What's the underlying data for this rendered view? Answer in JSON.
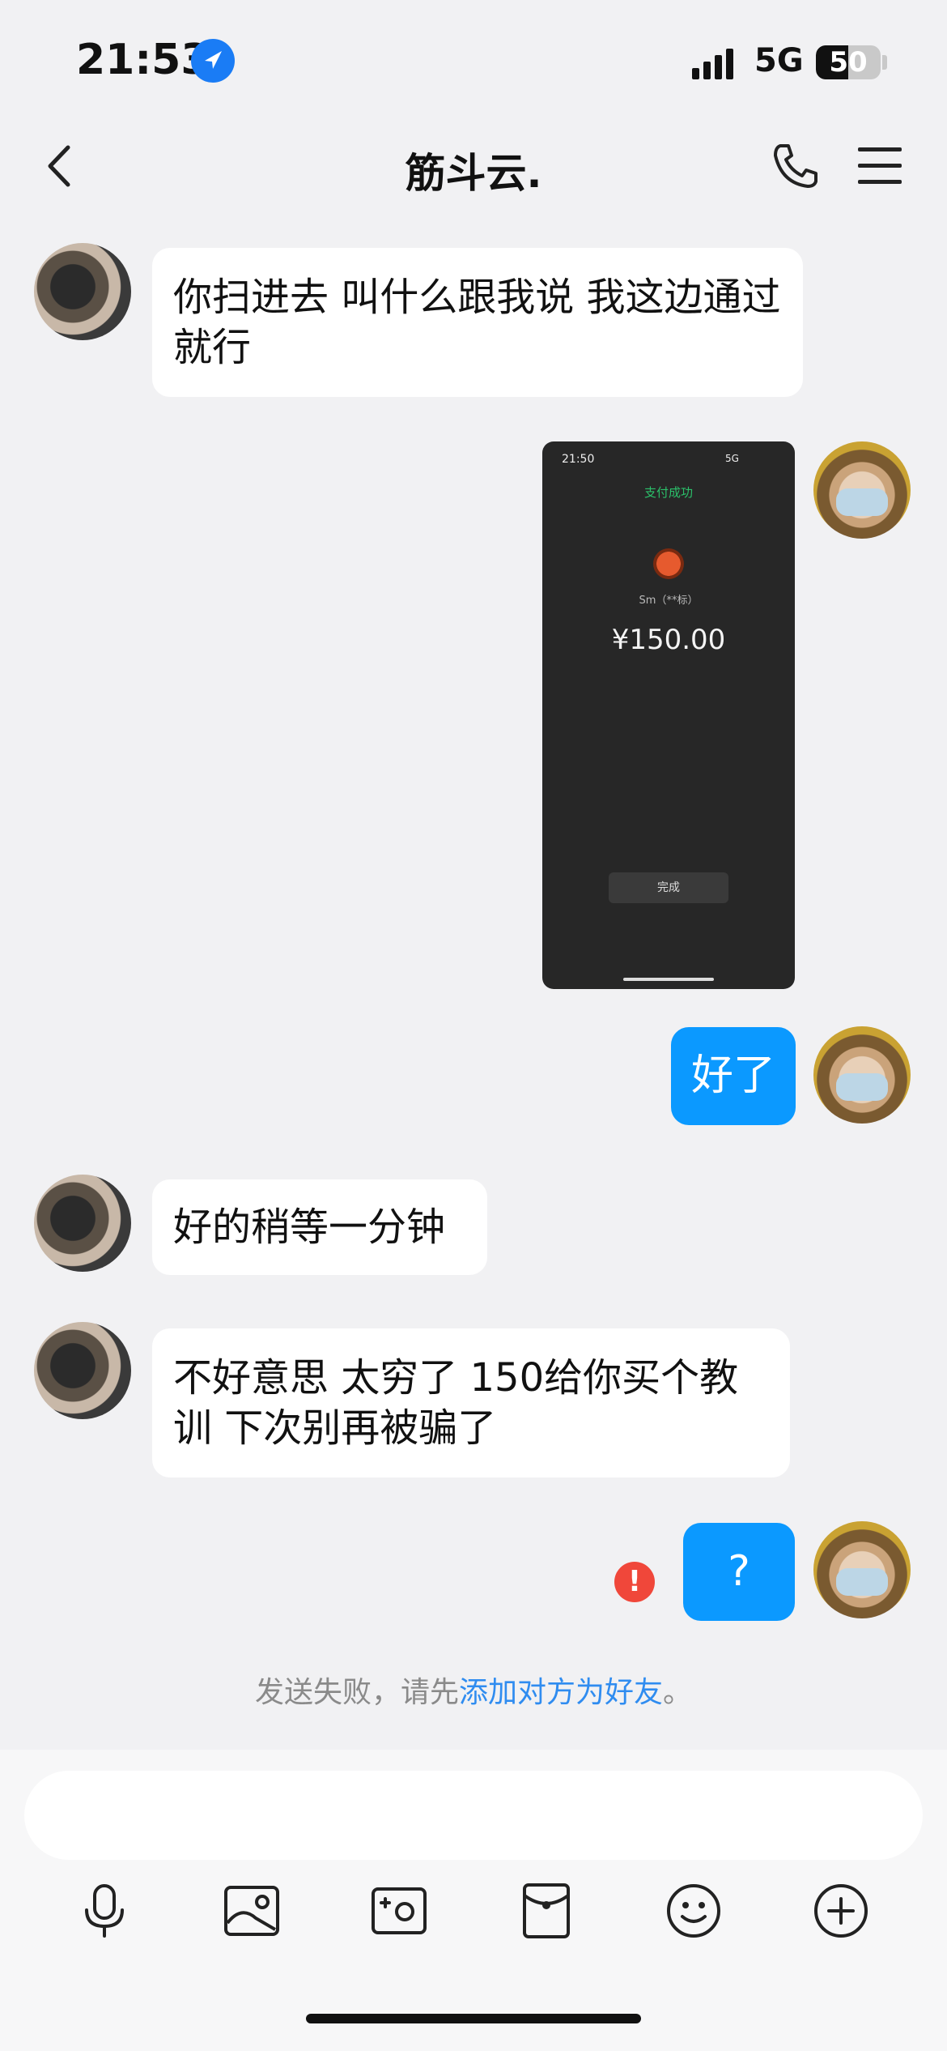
{
  "status_bar": {
    "time": "21:53",
    "network": "5G",
    "battery_level": "50",
    "battery_fraction": 0.5,
    "icons": [
      "location-arrow-icon",
      "signal-bars-icon",
      "battery-icon"
    ]
  },
  "nav": {
    "title": "筋斗云.",
    "icons": [
      "chevron-left-icon",
      "phone-icon",
      "menu-icon"
    ]
  },
  "messages": {
    "m1": "你扫进去 叫什么跟我说 我这边通过就行",
    "m3": "好了",
    "m4": "好的稍等一分钟",
    "m5": "不好意思 太穷了 150给你买个教训 下次别再被骗了",
    "m6": "?"
  },
  "screenshot": {
    "time": "21:50",
    "status": "5G",
    "success_label": "支付成功",
    "payee": "Sm（**标）",
    "amount": "¥150.00",
    "done_label": "完成"
  },
  "failure": {
    "prefix": "发送失败，请先",
    "link": "添加对方为好友",
    "suffix": "。",
    "icon_text": "!"
  },
  "composer": {
    "input_value": "",
    "tools": [
      "microphone-icon",
      "image-icon",
      "camera-icon",
      "red-packet-icon",
      "emoji-icon",
      "plus-icon"
    ]
  },
  "colors": {
    "accent": "#0b99ff",
    "background": "#f1f1f3",
    "error": "#f0473a",
    "link": "#2f8cf0"
  }
}
